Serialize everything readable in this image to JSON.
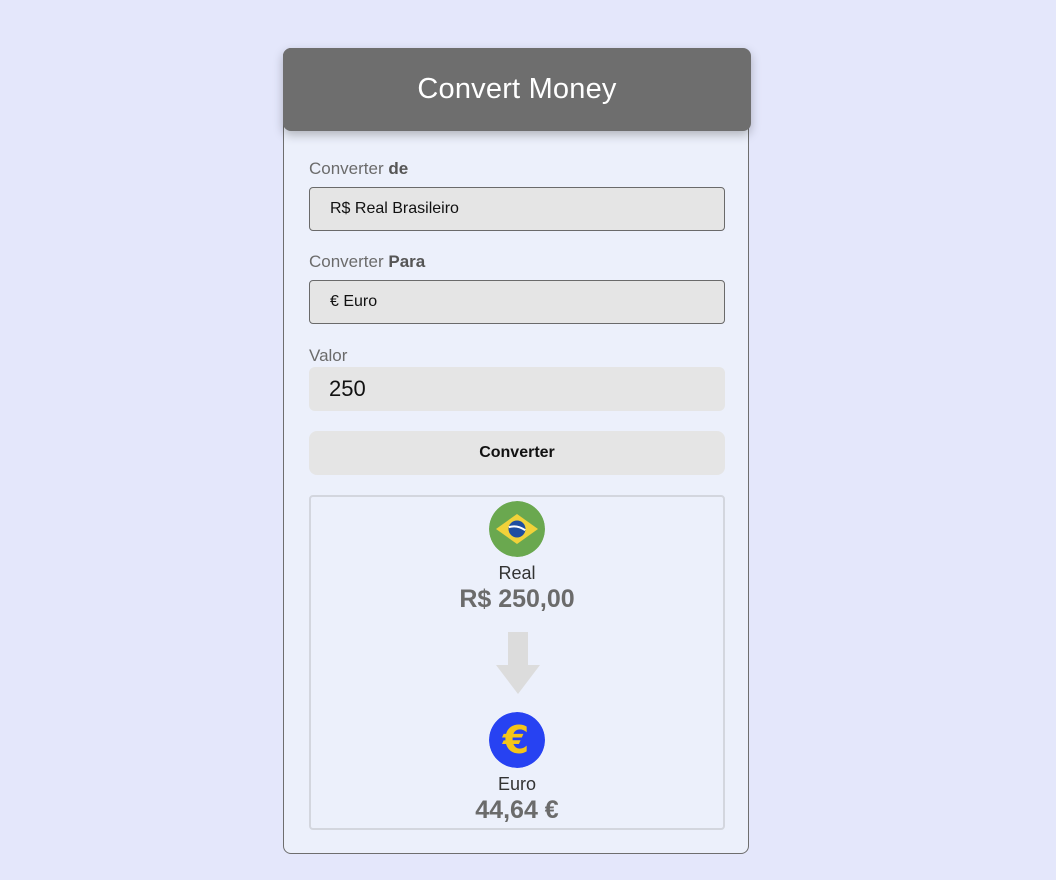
{
  "header": {
    "title": "Convert Money"
  },
  "from": {
    "label_prefix": "Converter",
    "label_bold": "de",
    "selected": "R$ Real Brasileiro"
  },
  "to": {
    "label_prefix": "Converter",
    "label_bold": "Para",
    "selected": "€ Euro"
  },
  "amount": {
    "label": "Valor",
    "value": "250"
  },
  "button": {
    "label": "Converter"
  },
  "result": {
    "from_name": "Real",
    "from_amount": "R$ 250,00",
    "from_flag_icon": "brazil-flag-icon",
    "arrow_icon": "arrow-down-icon",
    "to_name": "Euro",
    "to_amount": "44,64 €",
    "to_flag_icon": "euro-icon"
  },
  "colors": {
    "page_background": "#e4e7fb",
    "header_background": "#6e6e6e",
    "card_background": "#ecf0fb",
    "field_background": "#e5e5e5",
    "brazil_green": "#6aa84f",
    "brazil_yellow": "#f1d23a",
    "brazil_blue": "#1f4ea1",
    "euro_blue": "#2742f2",
    "euro_yellow": "#f5c518"
  }
}
